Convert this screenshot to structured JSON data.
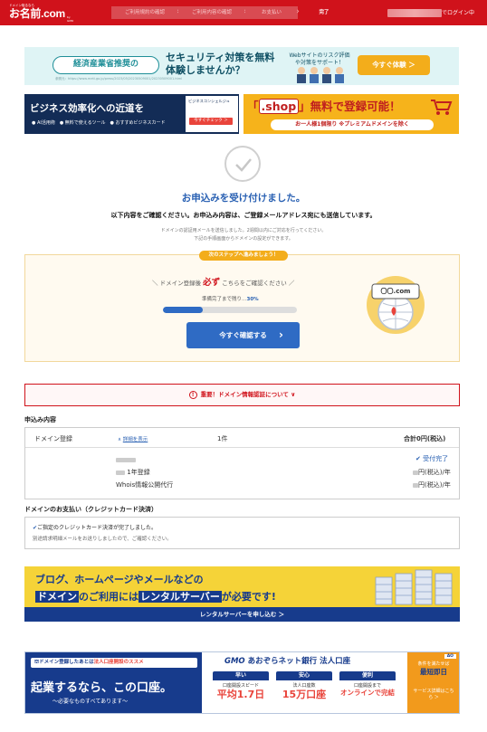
{
  "header": {
    "logo_tag": "ドメイン取るなら",
    "logo_main": "お名前.com",
    "logo_sub": "by GMO",
    "steps": [
      "ご利用規約の確認",
      "ご利用内容の確認",
      "お支払い",
      "完了"
    ],
    "current_step": 3,
    "account_suffix": "でログイン中"
  },
  "banner_security": {
    "pill": "経済産業省推奨の",
    "title": "セキュリティ対策を無料体験しませんか？",
    "side": "Webサイトのリスク評価や対策をサポート！",
    "cta": "今すぐ体験 ＞",
    "source": "参照元：https://www.meti.go.jp/press/2023/05/20230509001/20230509001.html"
  },
  "banner_business": {
    "title": "ビジネス効率化への近道を",
    "bullets": "● AI活用術　● 無料で使えるツール　● おすすめビジネスカード",
    "box_title": "ビジネスコンシェルジュ",
    "box_button": "今すぐチェック ＞"
  },
  "banner_shop": {
    "dot": ".shop",
    "title": "」無料で登録可能！",
    "sub": "お一人様1個限り ※プレミアムドメインを除く"
  },
  "confirmation": {
    "title": "お申込みを受け付けました。",
    "subtitle": "以下内容をご確認ください。お申込み内容は、ご登録メールアドレス宛にも送信しています。",
    "note_line1": "ドメインの認証用メールを送信しました。2週間以内にご対応を行ってください。",
    "note_line2": "下記の手順画面からドメインの設定ができます。"
  },
  "next_step": {
    "ribbon": "次のステップへ進みましょう！",
    "intro_before": "＼ ドメイン登録後",
    "intro_emph": "必ず",
    "intro_after": "こちらをご確認ください ／",
    "progress_label": "準備完了まで残り…",
    "progress_value": "30%",
    "progress_fraction": 0.3,
    "cta": "今すぐ確認する",
    "graphic_domain": "〇〇.com"
  },
  "alert": {
    "icon": "!",
    "text": "重要！ドメイン情報認証について",
    "chevron": "∨"
  },
  "order": {
    "section_title": "申込み内容",
    "header": {
      "item": "ドメイン登録",
      "detail": "詳細を表示",
      "count": "1件",
      "total": "合計0円(税込)"
    },
    "rows": [
      {
        "label": "",
        "right": "受付完了"
      },
      {
        "label": "1年登録",
        "right": "円(税込)/年"
      },
      {
        "label": "Whois情報公開代行",
        "right": "円(税込)/年"
      }
    ]
  },
  "payment": {
    "section_title": "ドメインのお支払い（クレジットカード決済）",
    "line1": "ご指定のクレジットカード決済が完了しました。",
    "line2": "別途請求明細メールをお送りしましたので、ご確認ください。"
  },
  "banner_rental": {
    "line1": "ブログ、ホームページやメールなどの",
    "line2_a": "ドメイン",
    "line2_b": "のご利用には",
    "line2_c": "レンタルサーバー",
    "line2_d": "が必要です!",
    "bar": "レンタルサーバーを申し込む ＞"
  },
  "banner_bank": {
    "tag_a": "ドメイン登録したあとは",
    "tag_b": "法人口座開設のススメ",
    "big": "起業するなら、この口座。",
    "small": "～必要なものすべてあります～",
    "head_a": "GMO",
    "head_b": "あおぞらネット銀行 法人口座",
    "cols": [
      {
        "label": "早い",
        "desc": "口座開設スピード",
        "value": "平均1.7日"
      },
      {
        "label": "安心",
        "desc": "法人口座数",
        "value": "15万口座"
      },
      {
        "label": "便利",
        "desc": "口座開設まで",
        "value": "オンラインで完結"
      }
    ],
    "ao": "AO",
    "cond": "条件を満たせば",
    "cond_big": "最短即日",
    "detail": "サービス詳細はこちら ＞"
  }
}
